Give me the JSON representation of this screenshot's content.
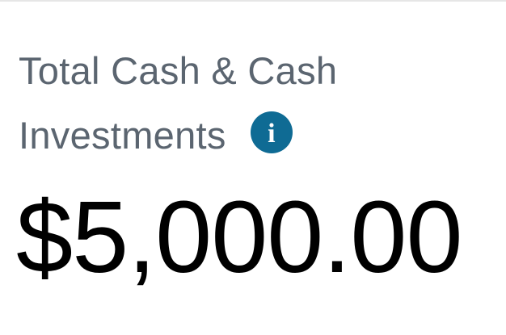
{
  "summary": {
    "label_line1": "Total Cash & Cash",
    "label_line2": "Investments",
    "amount": "$5,000.00",
    "info_icon": "info-circle-icon",
    "info_icon_glyph": "i",
    "colors": {
      "label": "#5b6570",
      "amount": "#000000",
      "info_icon": "#0f6b94"
    }
  }
}
